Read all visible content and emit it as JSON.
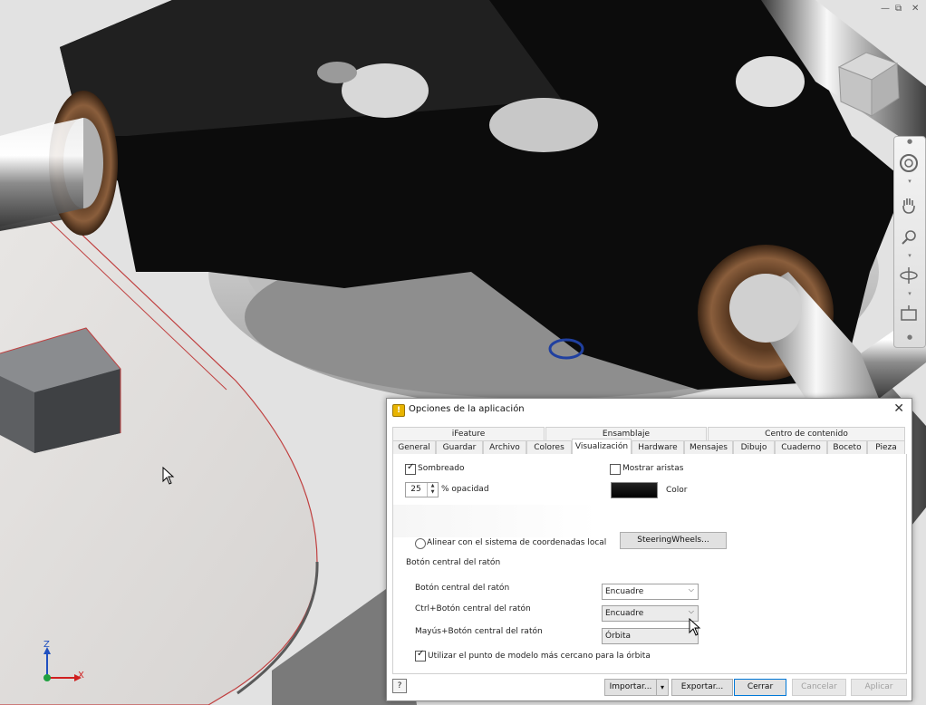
{
  "dialog": {
    "title": "Opciones de la aplicación",
    "tabs_row1": [
      "iFeature",
      "Ensamblaje",
      "Centro de contenido"
    ],
    "tabs_row2": [
      "General",
      "Guardar",
      "Archivo",
      "Colores",
      "Visualización",
      "Hardware",
      "Mensajes",
      "Dibujo",
      "Cuaderno",
      "Boceto",
      "Pieza"
    ],
    "active_tab": "Visualización",
    "sombreado_label": "Sombreado",
    "sombreado_checked": true,
    "mostrar_aristas_label": "Mostrar aristas",
    "mostrar_aristas_checked": false,
    "opacity_value": "25",
    "opacity_label": "% opacidad",
    "color_label": "Color",
    "align_label": "Alinear con el sistema de coordenadas local",
    "steeringwheels_label": "SteeringWheels...",
    "mouse_section_title": "Botón central del ratón",
    "rows": [
      {
        "label": "Botón central del ratón",
        "value": "Encuadre"
      },
      {
        "label": "Ctrl+Botón central del ratón",
        "value": "Encuadre"
      },
      {
        "label": "Mayús+Botón central del ratón",
        "value": "Órbita"
      }
    ],
    "nearest_point_label": "Utilizar el punto de modelo más cercano para la órbita",
    "nearest_point_checked": true,
    "buttons": {
      "importar": "Importar...",
      "exportar": "Exportar...",
      "cerrar": "Cerrar",
      "cancelar": "Cancelar",
      "aplicar": "Aplicar"
    }
  },
  "triad": {
    "z": "Z",
    "x": "X"
  },
  "colors": {
    "dialog_bg": "#ffffff",
    "active_button_border": "#0078d7",
    "axis_x": "#d02020",
    "axis_z": "#2050c0"
  }
}
